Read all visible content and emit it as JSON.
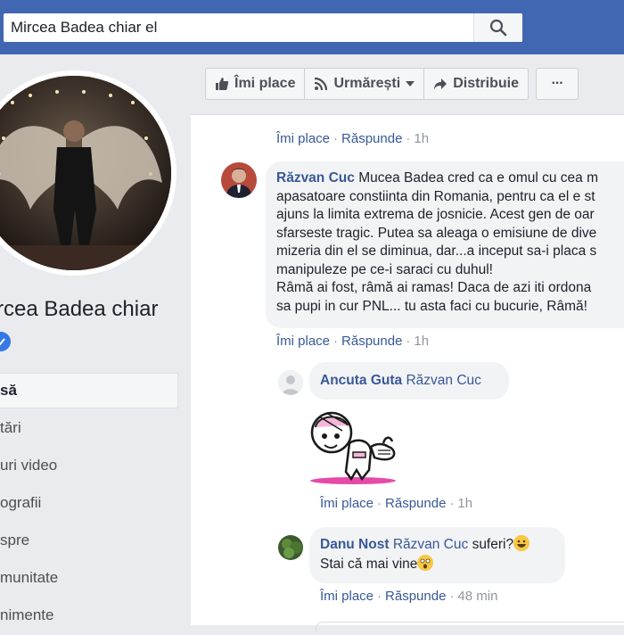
{
  "search": {
    "value": "Mircea Badea chiar el"
  },
  "profile": {
    "name": "Mircea Badea chiar el",
    "nav": [
      "Acasă",
      "Postări",
      "Clipuri video",
      "Fotografii",
      "Despre",
      "Comunitate",
      "Evenimente"
    ],
    "nav_visible": [
      "să",
      "tări",
      "uri video",
      "ografii",
      "spre",
      "munitate",
      "nimente"
    ],
    "name_visible": "rcea Badea chiar"
  },
  "actionbar": {
    "like": "Îmi place",
    "follow": "Urmărești",
    "share": "Distribuie",
    "more": "···"
  },
  "comment_actions": {
    "like": "Îmi place",
    "reply": "Răspunde",
    "sep": "·"
  },
  "comments": [
    {
      "id": "c0",
      "time": "1h"
    },
    {
      "id": "c1",
      "author": "Răzvan Cuc",
      "lines": [
        "Mucea Badea cred ca e omul cu cea m",
        "apasatoare constiinta din Romania, pentru ca el e st",
        "ajuns la limita extrema de josnicie. Acest gen de oar",
        "sfarseste tragic. Putea sa aleaga o emisiune de dive",
        "mizeria din el se diminua, dar...a inceput sa-i placa s",
        "manipuleze pe ce-i saraci cu duhul!",
        "Râmă ai fost, râmă ai ramas! Daca de azi iti ordona",
        "sa pupi in cur PNL... tu asta faci cu bucurie, Râmă!"
      ],
      "time": "1h"
    },
    {
      "id": "r1",
      "author": "Ancuta Guta",
      "mention": "Răzvan Cuc",
      "sticker": "thumbs-up-sticker",
      "time": "1h"
    },
    {
      "id": "r2",
      "author": "Danu Nost",
      "mention": "Răzvan Cuc",
      "text1": "suferi?",
      "text2": "Stai că mai vine",
      "time": "48 min"
    }
  ],
  "colors": {
    "brand": "#4267b2",
    "link": "#385898",
    "bubble": "#f2f3f5"
  }
}
